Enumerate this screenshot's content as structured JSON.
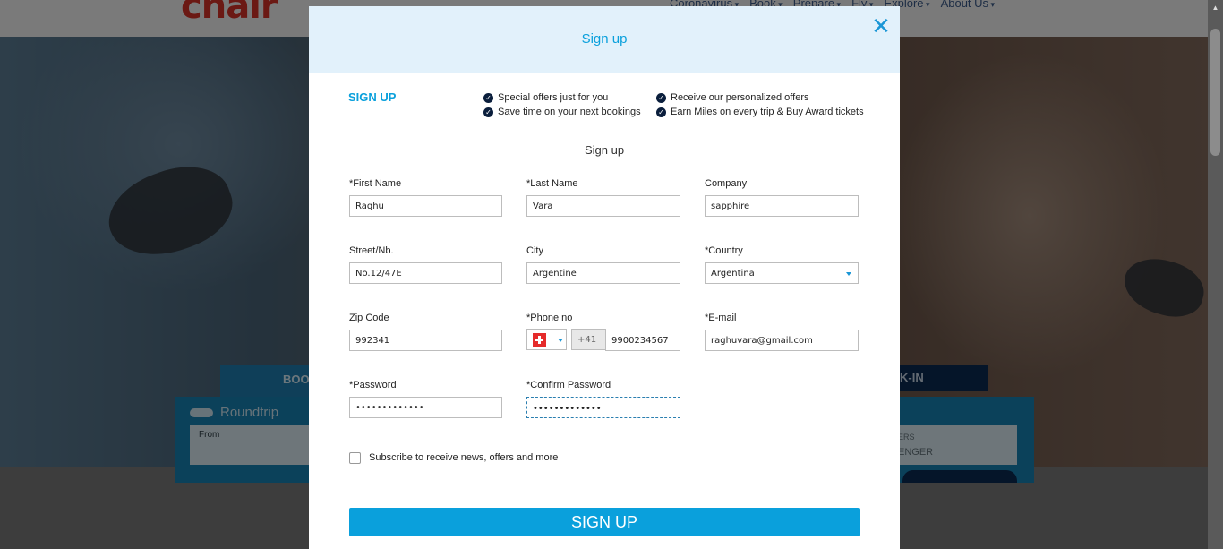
{
  "background": {
    "logo": "cnair",
    "nav": [
      "Coronavirus",
      "Book",
      "Prepare",
      "Fly",
      "Explore",
      "About Us"
    ],
    "booking_tab": "BOO",
    "checkin_tab": "K-IN",
    "roundtrip": "Roundtrip",
    "from_label": "From",
    "passenger_label": "ERS",
    "passenger_value": "ENGER"
  },
  "modal": {
    "title": "Sign up",
    "close_glyph": "✕",
    "sign_up_tag": "SIGN UP",
    "benefits": [
      "Special offers just for you",
      "Save time on your next bookings",
      "Receive our personalized offers",
      "Earn Miles on every trip & Buy Award tickets"
    ],
    "check_glyph": "✓",
    "form_title": "Sign up"
  },
  "form": {
    "first_name": {
      "label": "*First Name",
      "value": "Raghu"
    },
    "last_name": {
      "label": "*Last Name",
      "value": "Vara"
    },
    "company": {
      "label": "Company",
      "value": "sapphire"
    },
    "street": {
      "label": "Street/Nb.",
      "value": "No.12/47E"
    },
    "city": {
      "label": "City",
      "value": "Argentine"
    },
    "country": {
      "label": "*Country",
      "value": "Argentina"
    },
    "zip": {
      "label": "Zip Code",
      "value": "992341"
    },
    "phone": {
      "label": "*Phone no",
      "country_code": "+41",
      "value": "9900234567"
    },
    "email": {
      "label": "*E-mail",
      "value": "raghuvara@gmail.com"
    },
    "password": {
      "label": "*Password",
      "value": "•••••••••••••"
    },
    "confirm_password": {
      "label": "*Confirm Password",
      "value": "•••••••••••••"
    },
    "subscribe_label": "Subscribe to receive news, offers and more",
    "submit_label": "SIGN UP"
  }
}
